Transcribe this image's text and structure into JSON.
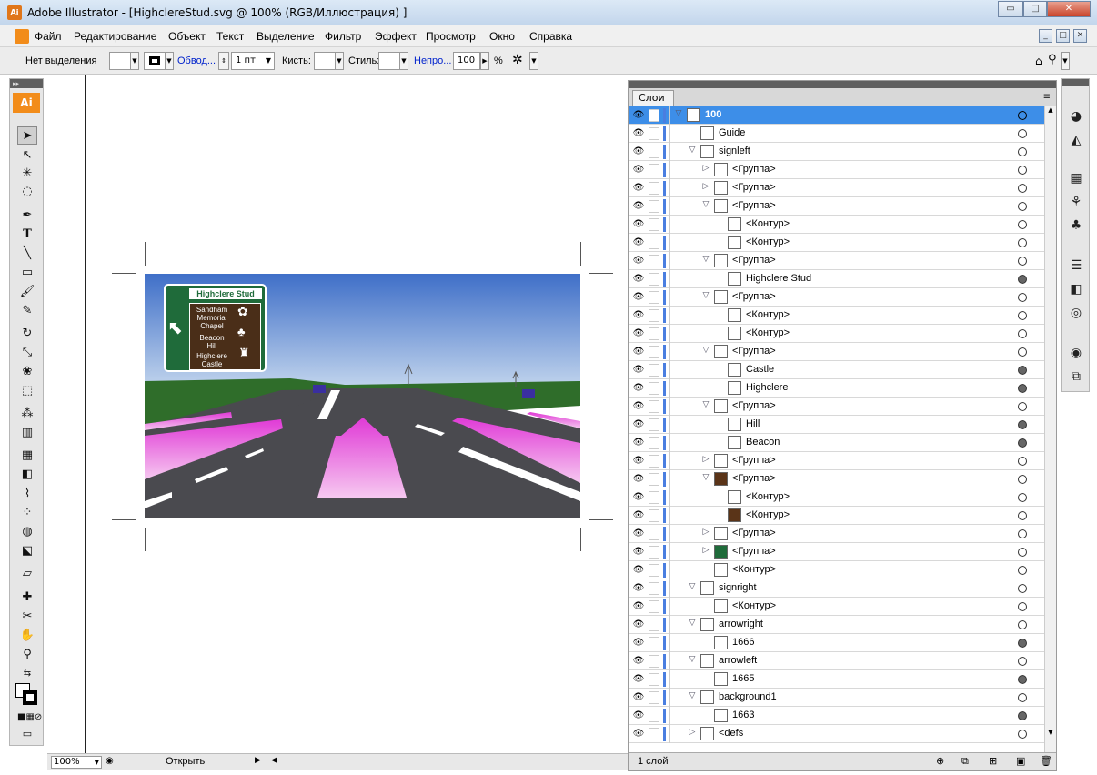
{
  "window": {
    "title": "Adobe Illustrator - [HighclereStud.svg @ 100% (RGB/Иллюстрация) ]",
    "app_icon": "Ai",
    "min": "▭",
    "max": "□",
    "close": "✕"
  },
  "menu": [
    "Файл",
    "Редактирование",
    "Объект",
    "Текст",
    "Выделение",
    "Фильтр",
    "Эффект",
    "Просмотр",
    "Окно",
    "Справка"
  ],
  "control": {
    "selection": "Нет выделения",
    "stroke_link": "Обвод...",
    "stroke_weight": "1 пт",
    "brush_label": "Кисть:",
    "style_label": "Стиль:",
    "opacity_link": "Непро...",
    "opacity_value": "100",
    "percent": "%"
  },
  "toolbox": {
    "logo": "Ai"
  },
  "status": {
    "zoom": "100%",
    "mode": "Открыть"
  },
  "sign": {
    "header": "Highclere Stud",
    "lines": [
      "Sandham",
      "Memorial",
      "Chapel",
      "Beacon",
      "Hill",
      "Highclere",
      "Castle"
    ]
  },
  "layers": {
    "tab": "Слои",
    "footer": "1 слой",
    "rows": [
      {
        "name": "100",
        "indent": 0,
        "tri": "▽",
        "active": true,
        "filled": false
      },
      {
        "name": "Guide",
        "indent": 1,
        "tri": "",
        "filled": false
      },
      {
        "name": "signleft",
        "indent": 1,
        "tri": "▽",
        "filled": false
      },
      {
        "name": "<Группа>",
        "indent": 2,
        "tri": "▷",
        "filled": false
      },
      {
        "name": "<Группа>",
        "indent": 2,
        "tri": "▷",
        "filled": false
      },
      {
        "name": "<Группа>",
        "indent": 2,
        "tri": "▽",
        "filled": false
      },
      {
        "name": "<Контур>",
        "indent": 3,
        "tri": "",
        "filled": false
      },
      {
        "name": "<Контур>",
        "indent": 3,
        "tri": "",
        "filled": false
      },
      {
        "name": "<Группа>",
        "indent": 2,
        "tri": "▽",
        "filled": false
      },
      {
        "name": "Highclere Stud",
        "indent": 3,
        "tri": "",
        "filled": true
      },
      {
        "name": "<Группа>",
        "indent": 2,
        "tri": "▽",
        "filled": false
      },
      {
        "name": "<Контур>",
        "indent": 3,
        "tri": "",
        "filled": false
      },
      {
        "name": "<Контур>",
        "indent": 3,
        "tri": "",
        "filled": false
      },
      {
        "name": "<Группа>",
        "indent": 2,
        "tri": "▽",
        "filled": false
      },
      {
        "name": "Castle",
        "indent": 3,
        "tri": "",
        "filled": true
      },
      {
        "name": "Highclere",
        "indent": 3,
        "tri": "",
        "filled": true
      },
      {
        "name": "<Группа>",
        "indent": 2,
        "tri": "▽",
        "filled": false
      },
      {
        "name": "Hill",
        "indent": 3,
        "tri": "",
        "filled": true
      },
      {
        "name": "Beacon",
        "indent": 3,
        "tri": "",
        "filled": true
      },
      {
        "name": "<Группа>",
        "indent": 2,
        "tri": "▷",
        "filled": false
      },
      {
        "name": "<Группа>",
        "indent": 2,
        "tri": "▽",
        "filled": false,
        "swatch": "#5a3418"
      },
      {
        "name": "<Контур>",
        "indent": 3,
        "tri": "",
        "filled": false
      },
      {
        "name": "<Контур>",
        "indent": 3,
        "tri": "",
        "filled": false,
        "swatch": "#5a3418"
      },
      {
        "name": "<Группа>",
        "indent": 2,
        "tri": "▷",
        "filled": false
      },
      {
        "name": "<Группа>",
        "indent": 2,
        "tri": "▷",
        "filled": false,
        "swatch": "#1f6b3a"
      },
      {
        "name": "<Контур>",
        "indent": 2,
        "tri": "",
        "filled": false
      },
      {
        "name": "signright",
        "indent": 1,
        "tri": "▽",
        "filled": false
      },
      {
        "name": "<Контур>",
        "indent": 2,
        "tri": "",
        "filled": false
      },
      {
        "name": "arrowright",
        "indent": 1,
        "tri": "▽",
        "filled": false
      },
      {
        "name": "1666",
        "indent": 2,
        "tri": "",
        "filled": true
      },
      {
        "name": "arrowleft",
        "indent": 1,
        "tri": "▽",
        "filled": false
      },
      {
        "name": "1665",
        "indent": 2,
        "tri": "",
        "filled": true
      },
      {
        "name": "background1",
        "indent": 1,
        "tri": "▽",
        "filled": false
      },
      {
        "name": "1663",
        "indent": 2,
        "tri": "",
        "filled": true
      },
      {
        "name": "<defs",
        "indent": 1,
        "tri": "▷",
        "filled": false
      }
    ]
  },
  "colors": {
    "accent": "#3d8ee8",
    "sign_green": "#1f6b3a",
    "sign_brown": "#4a2e18",
    "arrow_magenta": "#e040d0",
    "ai_orange": "#f28c1a"
  }
}
